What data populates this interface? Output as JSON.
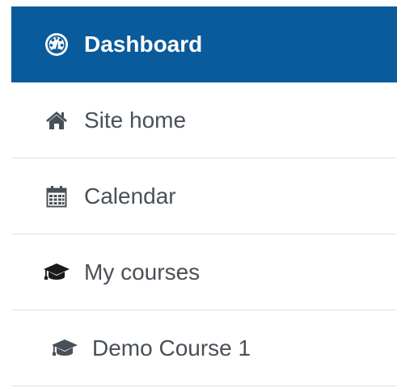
{
  "nav": {
    "items": [
      {
        "label": "Dashboard",
        "icon": "dashboard-icon",
        "active": true
      },
      {
        "label": "Site home",
        "icon": "home-icon"
      },
      {
        "label": "Calendar",
        "icon": "calendar-icon"
      },
      {
        "label": "My courses",
        "icon": "graduation-cap-icon"
      },
      {
        "label": "Demo Course 1",
        "icon": "graduation-cap-icon"
      }
    ]
  },
  "colors": {
    "active_bg": "#0a5b9c",
    "active_text": "#ffffff",
    "text": "#495057",
    "divider": "#dee2e6"
  }
}
